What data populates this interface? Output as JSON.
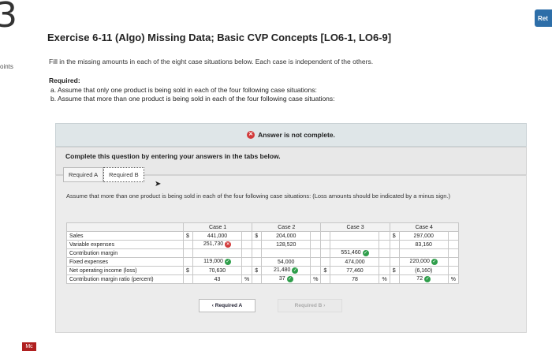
{
  "question_number": "3",
  "side_label": "oints",
  "return_label": "Ret",
  "brand_badge": "Mc",
  "title": "Exercise 6-11 (Algo) Missing Data; Basic CVP Concepts [LO6-1, LO6-9]",
  "instruction": "Fill in the missing amounts in each of the eight case situations below. Each case is independent of the others.",
  "required_heading": "Required:",
  "required_a": "a. Assume that only one product is being sold in each of the four following case situations:",
  "required_b": "b. Assume that more than one product is being sold in each of the four following case situations:",
  "answer_status": "Answer is not complete.",
  "complete_prompt": "Complete this question by entering your answers in the tabs below.",
  "tabs": [
    "Required A",
    "Required B"
  ],
  "panel_instruction": "Assume that more than one product is being sold in each of the four following case situations: (Loss amounts should be indicated by a minus sign.)",
  "table": {
    "headers": [
      "",
      "Case 1",
      "Case 2",
      "Case 3",
      "Case 4"
    ],
    "rows": [
      {
        "label": "Sales",
        "c1d": "$",
        "c1": "441,000",
        "c2d": "$",
        "c2": "204,000",
        "c3d": "",
        "c3": "",
        "c4d": "$",
        "c4": "297,000"
      },
      {
        "label": "Variable expenses",
        "c1d": "",
        "c1": "251,730",
        "c2d": "",
        "c2": "128,520",
        "c3d": "",
        "c3": "",
        "c4d": "",
        "c4": "83,160"
      },
      {
        "label": "Contribution margin",
        "c1d": "",
        "c1": "",
        "c2d": "",
        "c2": "",
        "c3d": "",
        "c3": "551,460",
        "c4d": "",
        "c4": ""
      },
      {
        "label": "Fixed expenses",
        "c1d": "",
        "c1": "119,000",
        "c2d": "",
        "c2": "54,000",
        "c3d": "",
        "c3": "474,000",
        "c4d": "",
        "c4": "220,000"
      },
      {
        "label": "Net operating income (loss)",
        "c1d": "$",
        "c1": "70,630",
        "c2d": "$",
        "c2": "21,480",
        "c3d": "$",
        "c3": "77,460",
        "c4d": "$",
        "c4": "(6,160)"
      },
      {
        "label": "Contribution margin ratio (percent)",
        "c1d": "",
        "c1": "43",
        "c2d": "",
        "c2": "37",
        "c3d": "",
        "c3": "78",
        "c4d": "",
        "c4": "72"
      }
    ],
    "percent_sign": "%"
  },
  "nav": {
    "prev": "Required A",
    "next": "Required B"
  },
  "colors": {
    "correct": "#2f9e4b",
    "incorrect": "#d23b3b"
  }
}
